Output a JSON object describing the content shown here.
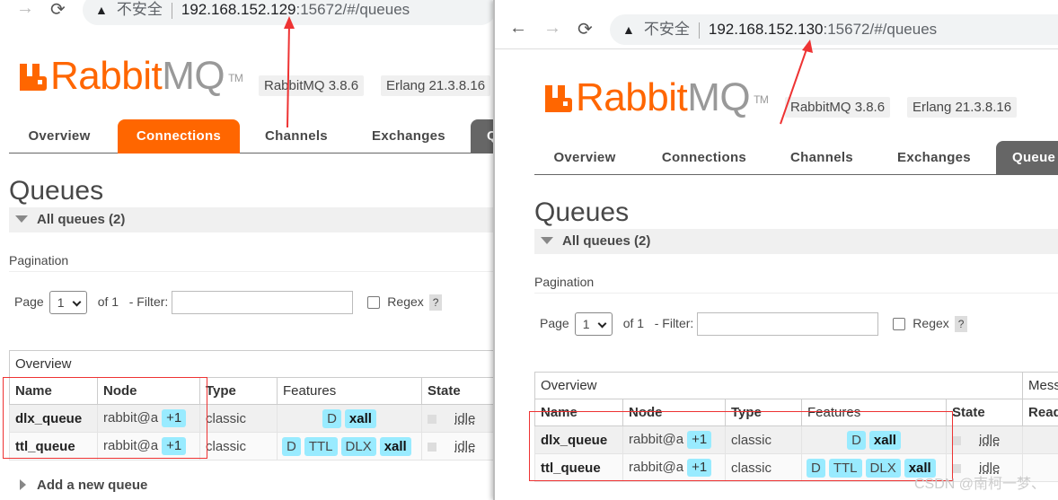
{
  "left": {
    "url": {
      "insecure_label": "不安全",
      "host": "192.168.152.129",
      "rest": ":15672/#/queues"
    },
    "brand": {
      "rabbit": "Rabbit",
      "mq": "MQ",
      "tm": "TM"
    },
    "versions": [
      "RabbitMQ 3.8.6",
      "Erlang 21.3.8.16"
    ],
    "tabs": [
      "Overview",
      "Connections",
      "Channels",
      "Exchanges",
      "Q"
    ],
    "active_tab": "Connections",
    "page_title": "Queues",
    "section_label": "All queues (2)",
    "pagination_label": "Pagination",
    "page_label": "Page",
    "page_value": "1",
    "of_label": "of 1",
    "filter_label": "- Filter:",
    "regex_label": "Regex",
    "help_label": "?",
    "table": {
      "group_header": "Overview",
      "headers": [
        "Name",
        "Node",
        "Type",
        "Features",
        "State"
      ],
      "rows": [
        {
          "name": "dlx_queue",
          "node": "rabbit@a",
          "node_extra": "+1",
          "type": "classic",
          "features": [
            "D",
            "xall"
          ],
          "state": "idle"
        },
        {
          "name": "ttl_queue",
          "node": "rabbit@a",
          "node_extra": "+1",
          "type": "classic",
          "features": [
            "D",
            "TTL",
            "DLX",
            "xall"
          ],
          "state": "idle"
        }
      ]
    },
    "add_queue_label": "Add a new queue"
  },
  "right": {
    "url": {
      "insecure_label": "不安全",
      "host": "192.168.152.130",
      "rest": ":15672/#/queues"
    },
    "brand": {
      "rabbit": "Rabbit",
      "mq": "MQ",
      "tm": "TM"
    },
    "versions": [
      "RabbitMQ 3.8.6",
      "Erlang 21.3.8.16"
    ],
    "tabs": [
      "Overview",
      "Connections",
      "Channels",
      "Exchanges",
      "Queue"
    ],
    "active_tab": "Queue",
    "page_title": "Queues",
    "section_label": "All queues (2)",
    "pagination_label": "Pagination",
    "page_label": "Page",
    "page_value": "1",
    "of_label": "of 1",
    "filter_label": "- Filter:",
    "regex_label": "Regex",
    "help_label": "?",
    "table": {
      "group_header": "Overview",
      "group_header_2": "Mess",
      "headers": [
        "Name",
        "Node",
        "Type",
        "Features",
        "State",
        "Read"
      ],
      "rows": [
        {
          "name": "dlx_queue",
          "node": "rabbit@a",
          "node_extra": "+1",
          "type": "classic",
          "features": [
            "D",
            "xall"
          ],
          "state": "idle"
        },
        {
          "name": "ttl_queue",
          "node": "rabbit@a",
          "node_extra": "+1",
          "type": "classic",
          "features": [
            "D",
            "TTL",
            "DLX",
            "xall"
          ],
          "state": "idle"
        }
      ]
    }
  },
  "watermark": "CSDN @南柯一梦、",
  "colors": {
    "brand_orange": "#ff6600",
    "feature_badge": "#99ebff",
    "annotation_red": "#e33333"
  }
}
